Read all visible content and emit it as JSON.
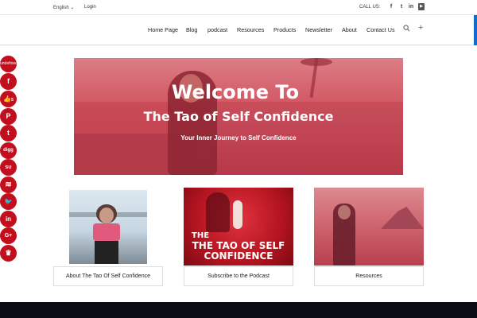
{
  "topbar": {
    "language": "English",
    "login": "Login",
    "call_us": "CALL US:",
    "social_icons": [
      "facebook-icon",
      "twitter-icon",
      "linkedin-icon",
      "youtube-icon"
    ]
  },
  "nav": {
    "items": [
      "Home Page",
      "Blog",
      "podcast",
      "Resources",
      "Products",
      "Newsletter",
      "About",
      "Contact Us"
    ],
    "search_icon": "search-icon",
    "plus_icon": "plus-icon",
    "accent_color": "#0d6ecd"
  },
  "hero": {
    "title": "Welcome To",
    "subtitle": "The Tao of Self Confidence",
    "tagline": "Your Inner Journey to Self Confidence",
    "tint_color": "#c94552"
  },
  "cards": [
    {
      "label": "About The Tao Of Self Confidence"
    },
    {
      "label": "Subscribe to the Podcast",
      "image_text": "THE TAO OF SELF CONFIDENCE"
    },
    {
      "label": "Resources"
    }
  ],
  "share_sidebar": {
    "first_label": "undefined",
    "count": "5",
    "color": "#c10f1e",
    "icons": [
      "share-icon",
      "facebook-icon",
      "like-icon",
      "pinterest-icon",
      "tumblr-icon",
      "digg-icon",
      "stumbleupon-icon",
      "buffer-icon",
      "twitter-icon",
      "linkedin-icon",
      "googleplus-icon",
      "crown-icon"
    ]
  }
}
